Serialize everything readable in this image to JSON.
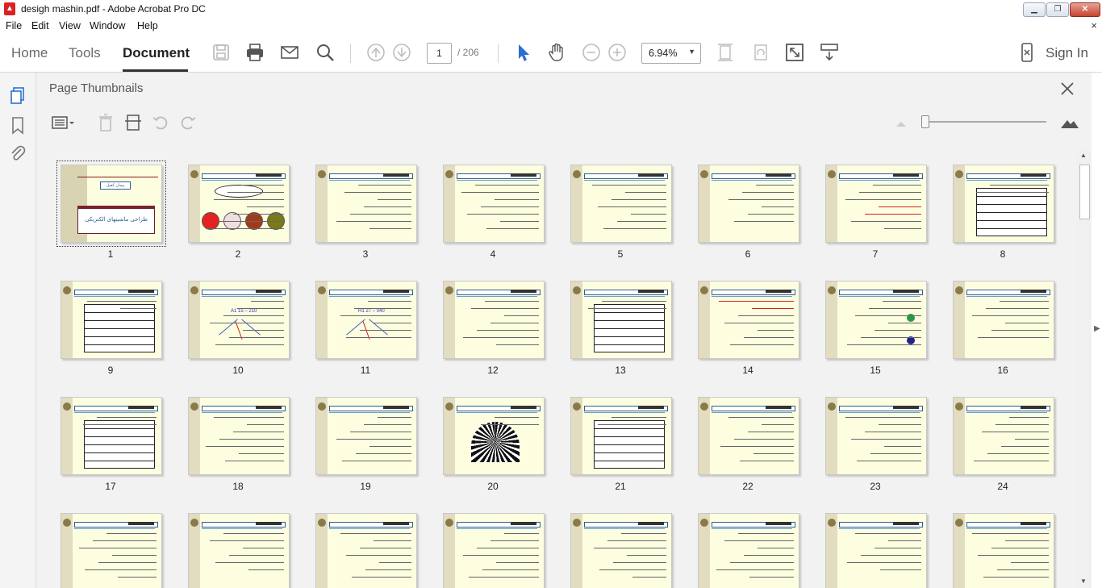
{
  "window": {
    "title": "desigh mashin.pdf - Adobe Acrobat Pro DC",
    "app_icon": "pdf-icon",
    "controls": [
      "minimize",
      "restore",
      "close"
    ]
  },
  "menu": {
    "items": [
      "File",
      "Edit",
      "View",
      "Window",
      "Help"
    ],
    "close_glyph": "×"
  },
  "toolbar": {
    "tabs": [
      "Home",
      "Tools",
      "Document"
    ],
    "active_tab": "Document",
    "page_current": "1",
    "page_total": "/ 206",
    "zoom": "6.94%",
    "sign_in": "Sign In",
    "icons": [
      "save-icon",
      "print-icon",
      "email-icon",
      "search-icon",
      "prev-page-icon",
      "next-page-icon",
      "select-tool-icon",
      "hand-tool-icon",
      "zoom-out-icon",
      "zoom-in-icon",
      "zoom-dropdown-icon",
      "fit-page-icon",
      "rotate-icon",
      "fullscreen-icon",
      "scroll-mode-icon",
      "mobile-link-icon"
    ]
  },
  "panel": {
    "title": "Page Thumbnails",
    "close_glyph": "✕"
  },
  "thumbnails": [
    {
      "page": "1"
    },
    {
      "page": "2"
    },
    {
      "page": "3"
    },
    {
      "page": "4"
    },
    {
      "page": "5"
    },
    {
      "page": "6"
    },
    {
      "page": "7"
    },
    {
      "page": "8"
    },
    {
      "page": "9"
    },
    {
      "page": "10"
    },
    {
      "page": "11"
    },
    {
      "page": "12"
    },
    {
      "page": "13"
    },
    {
      "page": "14"
    },
    {
      "page": "15"
    },
    {
      "page": "16"
    },
    {
      "page": "17"
    },
    {
      "page": "18"
    },
    {
      "page": "19"
    },
    {
      "page": "20"
    },
    {
      "page": "21"
    },
    {
      "page": "22"
    },
    {
      "page": "23"
    },
    {
      "page": "24"
    },
    {
      "page": ""
    },
    {
      "page": ""
    },
    {
      "page": ""
    },
    {
      "page": ""
    },
    {
      "page": ""
    },
    {
      "page": ""
    },
    {
      "page": ""
    },
    {
      "page": ""
    }
  ],
  "thumb_text": {
    "p1_box": "پيمان کفيل",
    "p1_title": "طراحی ماشینهای الکتریکی",
    "p10_label": "A1 15 – 210",
    "p11_label": "H1 27 – 040"
  },
  "colors": {
    "page_bg": "#fdfde0",
    "header_blue": "#2b5d9b",
    "accent_red": "#d62020",
    "panel_bg": "#f2f2f2"
  }
}
